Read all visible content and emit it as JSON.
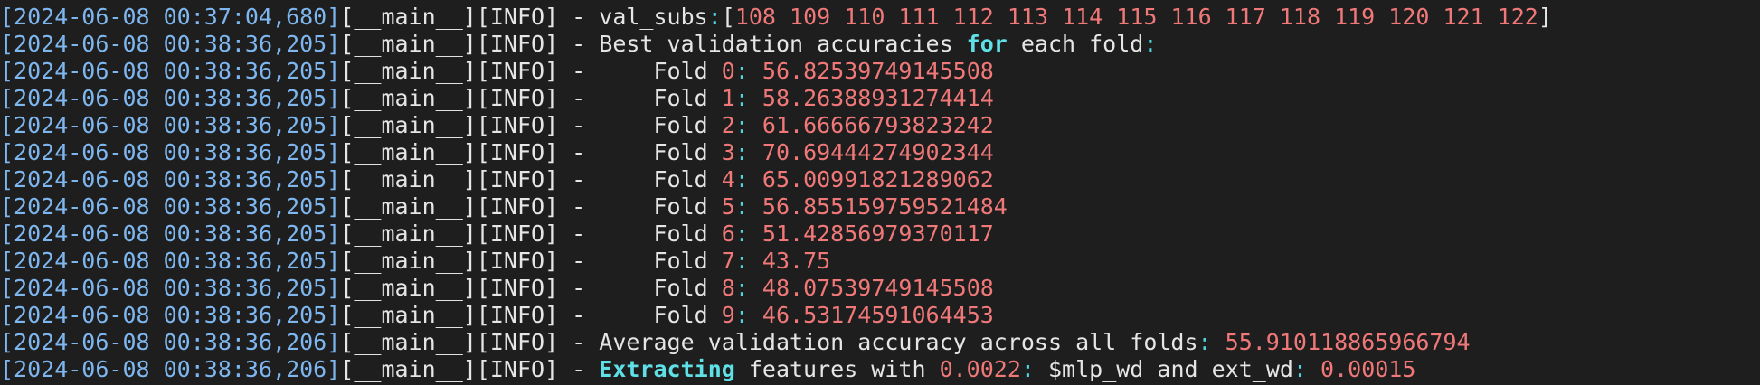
{
  "colors": {
    "background": "#1e1e1e",
    "timestamp": "#7eb6ef",
    "text": "#e6e6e6",
    "number": "#f07878",
    "keyword": "#4fd6e0"
  },
  "lines": [
    {
      "ts": "[2024-06-08 00:37:04,680]",
      "logger": "[__main__][INFO]",
      "sep": " - ",
      "msg": [
        {
          "t": "val_subs",
          "c": "plain"
        },
        {
          "t": ":",
          "c": "kw"
        },
        {
          "t": "[",
          "c": "plain"
        },
        {
          "t": "108 109 110 111 112 113 114 115 116 117 118 119 120 121 122",
          "c": "num"
        },
        {
          "t": "]",
          "c": "plain"
        }
      ]
    },
    {
      "ts": "[2024-06-08 00:38:36,205]",
      "logger": "[__main__][INFO]",
      "sep": " - ",
      "msg": [
        {
          "t": "Best validation accuracies ",
          "c": "plain"
        },
        {
          "t": "for",
          "c": "kwb"
        },
        {
          "t": " each fold",
          "c": "plain"
        },
        {
          "t": ":",
          "c": "kw"
        }
      ]
    },
    {
      "ts": "[2024-06-08 00:38:36,205]",
      "logger": "[__main__][INFO]",
      "sep": " - ",
      "msg": [
        {
          "t": "    Fold ",
          "c": "plain"
        },
        {
          "t": "0",
          "c": "num"
        },
        {
          "t": ": ",
          "c": "kw"
        },
        {
          "t": "56.82539749145508",
          "c": "num"
        }
      ]
    },
    {
      "ts": "[2024-06-08 00:38:36,205]",
      "logger": "[__main__][INFO]",
      "sep": " - ",
      "msg": [
        {
          "t": "    Fold ",
          "c": "plain"
        },
        {
          "t": "1",
          "c": "num"
        },
        {
          "t": ": ",
          "c": "kw"
        },
        {
          "t": "58.26388931274414",
          "c": "num"
        }
      ]
    },
    {
      "ts": "[2024-06-08 00:38:36,205]",
      "logger": "[__main__][INFO]",
      "sep": " - ",
      "msg": [
        {
          "t": "    Fold ",
          "c": "plain"
        },
        {
          "t": "2",
          "c": "num"
        },
        {
          "t": ": ",
          "c": "kw"
        },
        {
          "t": "61.66666793823242",
          "c": "num"
        }
      ]
    },
    {
      "ts": "[2024-06-08 00:38:36,205]",
      "logger": "[__main__][INFO]",
      "sep": " - ",
      "msg": [
        {
          "t": "    Fold ",
          "c": "plain"
        },
        {
          "t": "3",
          "c": "num"
        },
        {
          "t": ": ",
          "c": "kw"
        },
        {
          "t": "70.69444274902344",
          "c": "num"
        }
      ]
    },
    {
      "ts": "[2024-06-08 00:38:36,205]",
      "logger": "[__main__][INFO]",
      "sep": " - ",
      "msg": [
        {
          "t": "    Fold ",
          "c": "plain"
        },
        {
          "t": "4",
          "c": "num"
        },
        {
          "t": ": ",
          "c": "kw"
        },
        {
          "t": "65.00991821289062",
          "c": "num"
        }
      ]
    },
    {
      "ts": "[2024-06-08 00:38:36,205]",
      "logger": "[__main__][INFO]",
      "sep": " - ",
      "msg": [
        {
          "t": "    Fold ",
          "c": "plain"
        },
        {
          "t": "5",
          "c": "num"
        },
        {
          "t": ": ",
          "c": "kw"
        },
        {
          "t": "56.855159759521484",
          "c": "num"
        }
      ]
    },
    {
      "ts": "[2024-06-08 00:38:36,205]",
      "logger": "[__main__][INFO]",
      "sep": " - ",
      "msg": [
        {
          "t": "    Fold ",
          "c": "plain"
        },
        {
          "t": "6",
          "c": "num"
        },
        {
          "t": ": ",
          "c": "kw"
        },
        {
          "t": "51.42856979370117",
          "c": "num"
        }
      ]
    },
    {
      "ts": "[2024-06-08 00:38:36,205]",
      "logger": "[__main__][INFO]",
      "sep": " - ",
      "msg": [
        {
          "t": "    Fold ",
          "c": "plain"
        },
        {
          "t": "7",
          "c": "num"
        },
        {
          "t": ": ",
          "c": "kw"
        },
        {
          "t": "43.75",
          "c": "num"
        }
      ]
    },
    {
      "ts": "[2024-06-08 00:38:36,205]",
      "logger": "[__main__][INFO]",
      "sep": " - ",
      "msg": [
        {
          "t": "    Fold ",
          "c": "plain"
        },
        {
          "t": "8",
          "c": "num"
        },
        {
          "t": ": ",
          "c": "kw"
        },
        {
          "t": "48.07539749145508",
          "c": "num"
        }
      ]
    },
    {
      "ts": "[2024-06-08 00:38:36,205]",
      "logger": "[__main__][INFO]",
      "sep": " - ",
      "msg": [
        {
          "t": "    Fold ",
          "c": "plain"
        },
        {
          "t": "9",
          "c": "num"
        },
        {
          "t": ": ",
          "c": "kw"
        },
        {
          "t": "46.53174591064453",
          "c": "num"
        }
      ]
    },
    {
      "ts": "[2024-06-08 00:38:36,206]",
      "logger": "[__main__][INFO]",
      "sep": " - ",
      "msg": [
        {
          "t": "Average validation accuracy across all folds",
          "c": "plain"
        },
        {
          "t": ": ",
          "c": "kw"
        },
        {
          "t": "55.910118865966794",
          "c": "num"
        }
      ]
    },
    {
      "ts": "[2024-06-08 00:38:36,206]",
      "logger": "[__main__][INFO]",
      "sep": " - ",
      "msg": [
        {
          "t": "Extracting",
          "c": "kwb"
        },
        {
          "t": " features with ",
          "c": "plain"
        },
        {
          "t": "0.0022",
          "c": "num"
        },
        {
          "t": ": ",
          "c": "kw"
        },
        {
          "t": "$mlp_wd and ext_wd",
          "c": "plain"
        },
        {
          "t": ": ",
          "c": "kw"
        },
        {
          "t": "0.00015",
          "c": "num"
        }
      ]
    }
  ]
}
